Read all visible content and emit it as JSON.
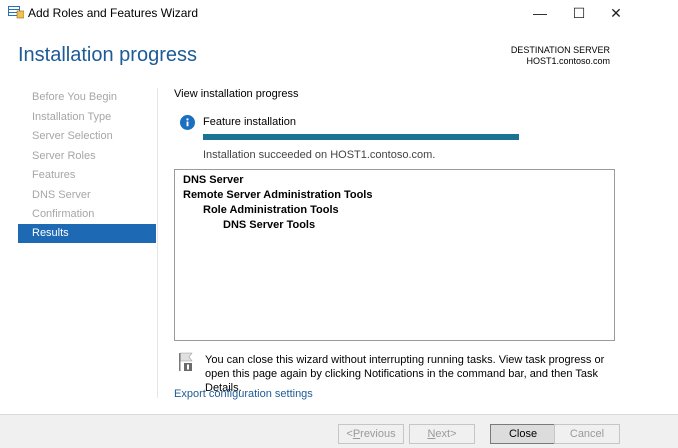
{
  "window": {
    "title": "Add Roles and Features Wizard",
    "minimize_glyph": "—",
    "maximize_glyph": "☐",
    "close_glyph": "✕"
  },
  "header": {
    "title": "Installation progress",
    "destination_label": "DESTINATION SERVER",
    "destination_host": "HOST1.contoso.com"
  },
  "nav": {
    "items": [
      {
        "label": "Before You Begin",
        "active": false
      },
      {
        "label": "Installation Type",
        "active": false
      },
      {
        "label": "Server Selection",
        "active": false
      },
      {
        "label": "Server Roles",
        "active": false
      },
      {
        "label": "Features",
        "active": false
      },
      {
        "label": "DNS Server",
        "active": false
      },
      {
        "label": "Confirmation",
        "active": false
      },
      {
        "label": "Results",
        "active": true
      }
    ]
  },
  "main": {
    "heading": "View installation progress",
    "feature_label": "Feature installation",
    "progress_fraction": 1.0,
    "status": "Installation succeeded on HOST1.contoso.com.",
    "results": [
      {
        "label": "DNS Server",
        "level": 0
      },
      {
        "label": "Remote Server Administration Tools",
        "level": 0
      },
      {
        "label": "Role Administration Tools",
        "level": 1
      },
      {
        "label": "DNS Server Tools",
        "level": 2
      }
    ],
    "notice": "You can close this wizard without interrupting running tasks. View task progress or open this page again by clicking Notifications in the command bar, and then Task Details.",
    "export_link": "Export configuration settings"
  },
  "buttons": {
    "previous": {
      "mnemonic": "P",
      "rest": "revious",
      "prefix": "< ",
      "suffix": ""
    },
    "next": {
      "mnemonic": "N",
      "rest": "ext",
      "prefix": "",
      "suffix": " >"
    },
    "close": "Close",
    "cancel": "Cancel"
  },
  "colors": {
    "accent": "#1e69b4",
    "title": "#1c5b97",
    "progress": "#1a7393",
    "info_icon": "#1a6fc0"
  }
}
